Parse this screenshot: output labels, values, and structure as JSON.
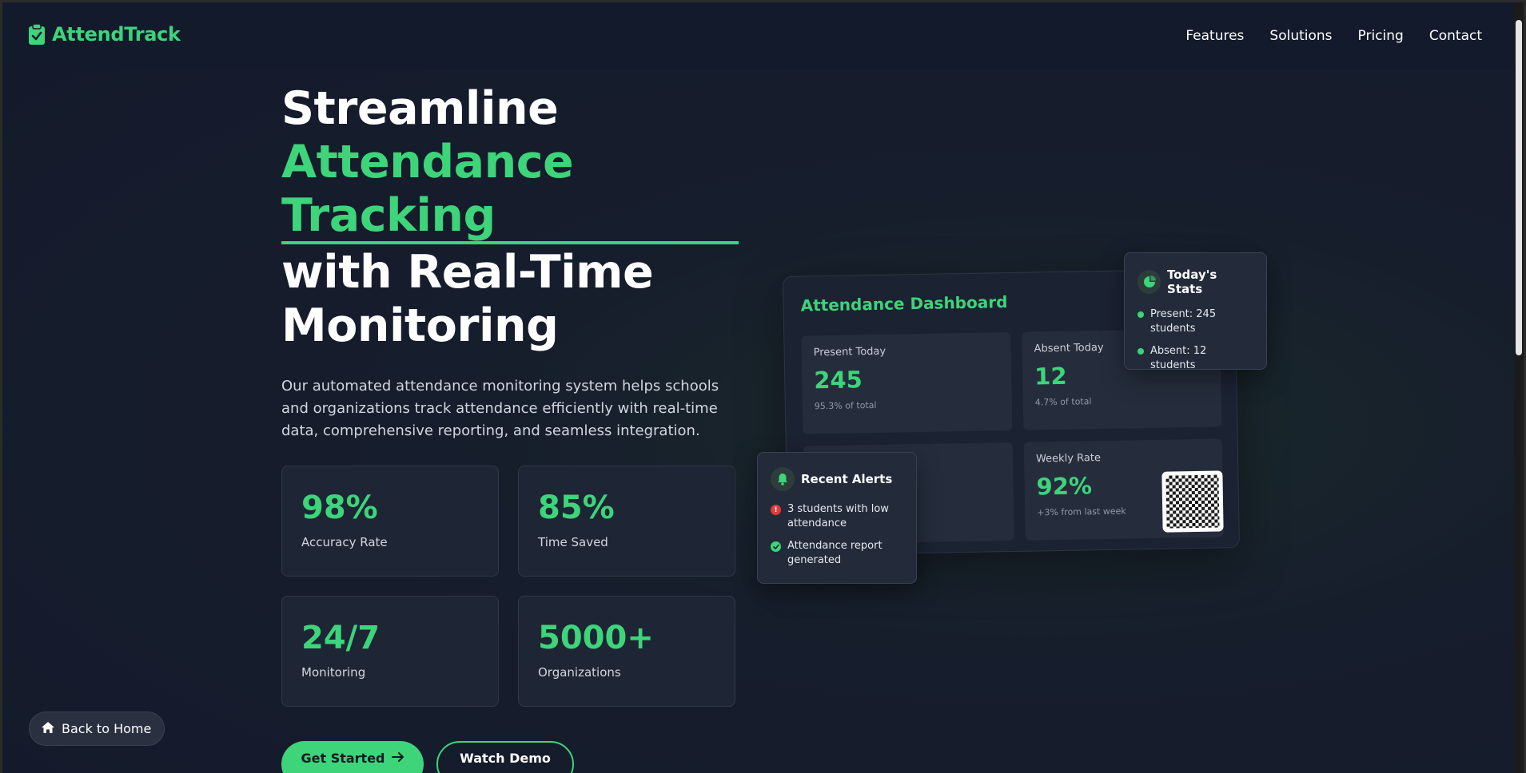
{
  "brand": {
    "name": "AttendTrack",
    "accent": "#3dd47a"
  },
  "nav": {
    "items": [
      "Features",
      "Solutions",
      "Pricing",
      "Contact"
    ]
  },
  "hero": {
    "line1": "Streamline",
    "line2": "Attendance",
    "line3": "Tracking",
    "line4": "with Real-Time",
    "line5": "Monitoring",
    "description": "Our automated attendance monitoring system helps schools and organizations track attendance efficiently with real-time data, comprehensive reporting, and seamless integration."
  },
  "stats": [
    {
      "value": "98%",
      "label": "Accuracy Rate"
    },
    {
      "value": "85%",
      "label": "Time Saved"
    },
    {
      "value": "24/7",
      "label": "Monitoring"
    },
    {
      "value": "5000+",
      "label": "Organizations"
    }
  ],
  "buttons": {
    "primary": "Get Started",
    "secondary": "Watch Demo",
    "back_home": "Back to Home"
  },
  "dashboard": {
    "title": "Attendance Dashboard",
    "cards": {
      "present": {
        "label": "Present Today",
        "value": "245",
        "sub": "95.3% of total"
      },
      "absent": {
        "label": "Absent Today",
        "value": "12",
        "sub": "4.7% of total"
      },
      "weekly": {
        "label": "Weekly Rate",
        "value": "92%",
        "sub": "+3% from last week"
      }
    }
  },
  "todays_stats": {
    "title": "Today's Stats",
    "items": [
      "Present: 245 students",
      "Absent: 12 students"
    ]
  },
  "alerts": {
    "title": "Recent Alerts",
    "items": [
      {
        "text": "3 students with low attendance",
        "status": "error",
        "color": "#e23b3b"
      },
      {
        "text": "Attendance report generated",
        "status": "success",
        "color": "#3dd47a"
      }
    ]
  }
}
